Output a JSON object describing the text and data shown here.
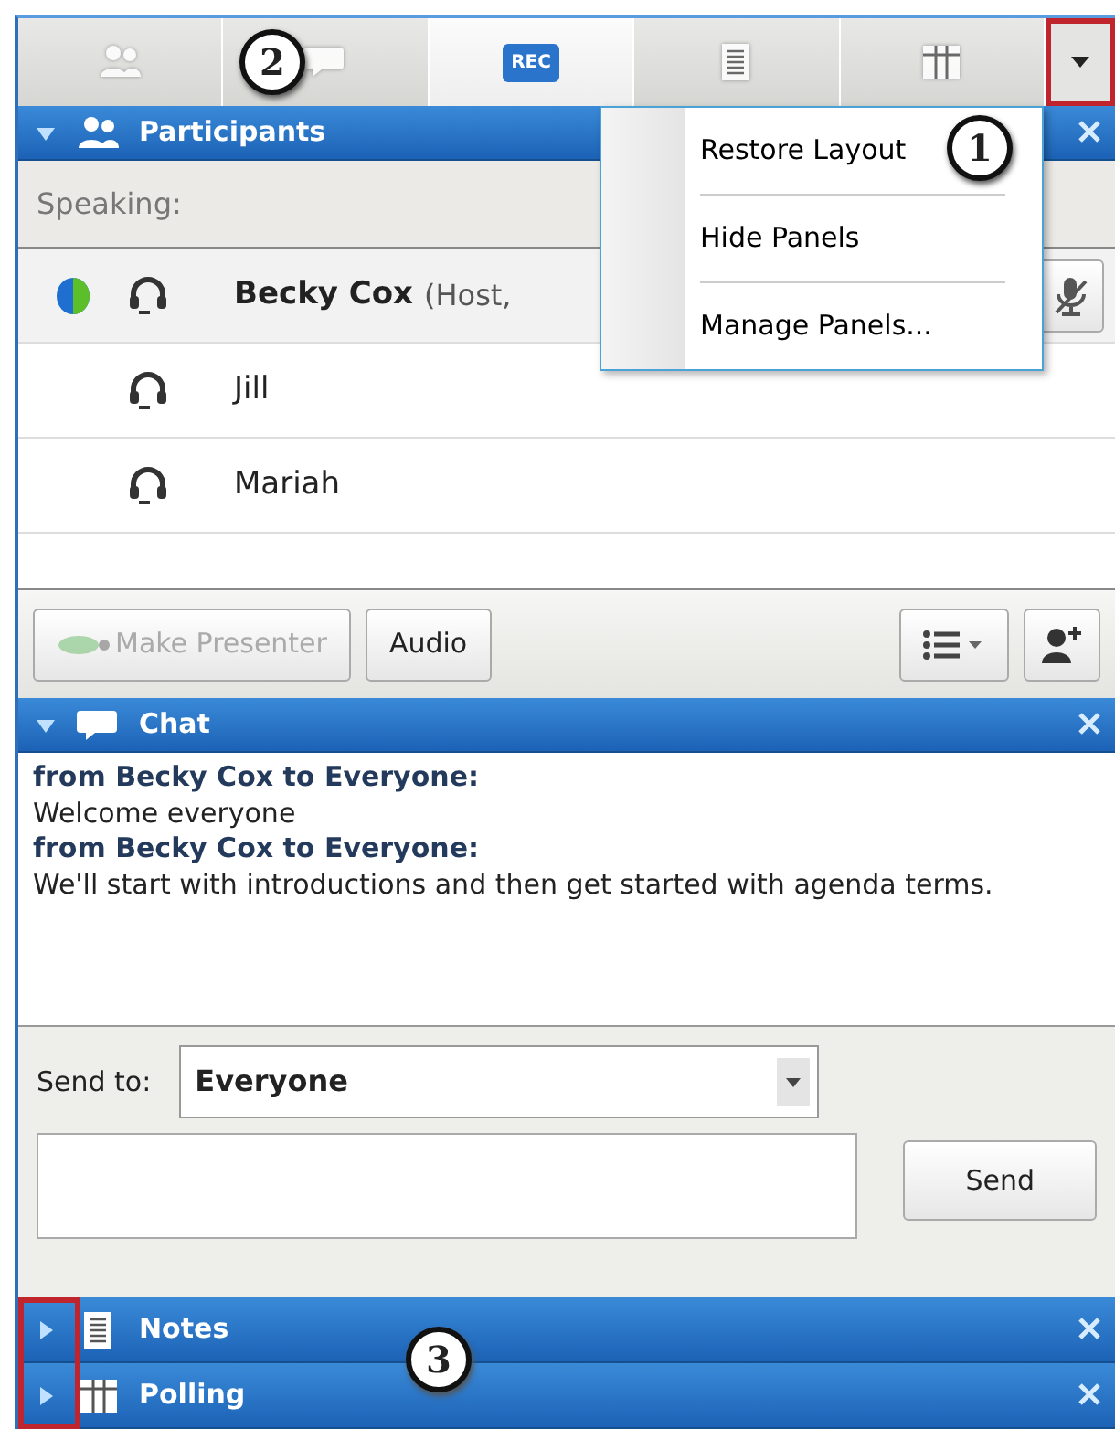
{
  "toolbar": {
    "callout": "2",
    "tabs": [
      {
        "kind": "participants",
        "selected": false
      },
      {
        "kind": "chat",
        "selected": false
      },
      {
        "kind": "rec",
        "label": "REC",
        "selected": true
      },
      {
        "kind": "notes",
        "selected": false
      },
      {
        "kind": "polling",
        "selected": false
      }
    ],
    "menu_button": {
      "highlighted": true
    }
  },
  "menu": {
    "callout": "1",
    "items": [
      {
        "label": "Restore Layout"
      },
      {
        "label": "Hide Panels"
      },
      {
        "label": "Manage Panels..."
      }
    ]
  },
  "participants_panel": {
    "title": "Participants",
    "expanded": true,
    "speaking_label": "Speaking:",
    "people": [
      {
        "name": "Becky Cox",
        "note": "(Host,",
        "kind": "host"
      },
      {
        "name": "Jill",
        "kind": "attendee"
      },
      {
        "name": "Mariah",
        "kind": "attendee"
      }
    ],
    "buttons": [
      {
        "label": "Make Presenter",
        "disabled": true
      },
      {
        "label": "Audio",
        "disabled": false
      }
    ]
  },
  "chat_panel": {
    "title": "Chat",
    "expanded": true,
    "messages": [
      {
        "kind": "header",
        "text": "from Becky Cox to Everyone:"
      },
      {
        "kind": "body",
        "text": "Welcome everyone"
      },
      {
        "kind": "header",
        "text": "from Becky Cox to Everyone:"
      },
      {
        "kind": "body",
        "text": "We'll start with introductions and then get started with agenda terms."
      }
    ],
    "send_to_label": "Send to:",
    "send_to_value": "Everyone",
    "send_button": "Send"
  },
  "collapsed_panels": {
    "callout": "3",
    "highlighted": true,
    "panels": [
      {
        "kind": "notes",
        "title": "Notes",
        "expanded": false
      },
      {
        "kind": "polling",
        "title": "Polling",
        "expanded": false
      }
    ]
  }
}
